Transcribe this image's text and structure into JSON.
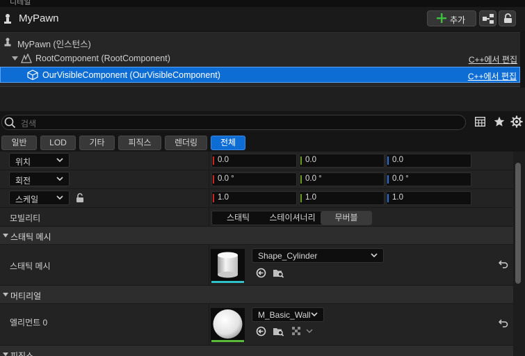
{
  "window": {
    "tab_label": "디테일"
  },
  "header": {
    "title": "MyPawn",
    "add_button": "추가"
  },
  "tree": {
    "rows": [
      {
        "label": "MyPawn (인스턴스)",
        "edit": ""
      },
      {
        "label": "RootComponent (RootComponent)",
        "edit": "C++에서 편집"
      },
      {
        "label": "OurVisibleComponent (OurVisibleComponent)",
        "edit": "C++에서 편집"
      }
    ]
  },
  "search": {
    "placeholder": "검색"
  },
  "category_tabs": [
    "일반",
    "LOD",
    "기타",
    "피직스",
    "렌더링",
    "전체"
  ],
  "active_tab": "전체",
  "transform": {
    "location": {
      "label": "위치",
      "x": "0.0",
      "y": "0.0",
      "z": "0.0"
    },
    "rotation": {
      "label": "회전",
      "x": "0.0 °",
      "y": "0.0 °",
      "z": "0.0 °"
    },
    "scale": {
      "label": "스케일",
      "x": "1.0",
      "y": "1.0",
      "z": "1.0"
    }
  },
  "mobility": {
    "label": "모빌리티",
    "options": [
      "스태틱",
      "스테이셔너리",
      "무버블"
    ],
    "selected": "무버블"
  },
  "sections": {
    "static_mesh": {
      "title": "스태틱 메시",
      "prop_label": "스태틱 메시",
      "value": "Shape_Cylinder"
    },
    "material": {
      "title": "머티리얼",
      "prop_label": "엘리먼트 0",
      "value": "M_Basic_Wall"
    },
    "physics": {
      "title": "피직스"
    }
  },
  "colors": {
    "accent": "#0e6dd4",
    "axis_x": "#c8281e",
    "axis_y": "#6a9a1f",
    "axis_z": "#2a6fd6",
    "mesh_line": "#2fc0c8",
    "material_line": "#5aba3a"
  }
}
